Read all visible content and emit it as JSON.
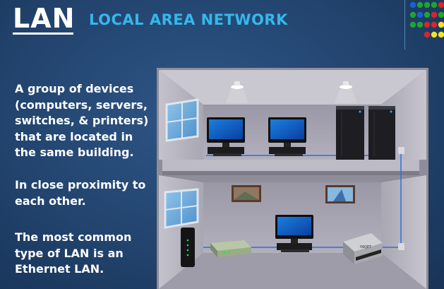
{
  "header": {
    "abbrev": "LAN",
    "title": "LOCAL AREA NETWORK"
  },
  "body_text": {
    "p1_lines": [
      "A group of devices",
      "(computers, servers,",
      "switches, & printers)",
      "that are located in",
      "the same building."
    ],
    "p2_lines": [
      "In close proximity to",
      "each other."
    ],
    "p3_lines": [
      "The most common",
      "type of LAN is an",
      "Ethernet LAN."
    ]
  },
  "colors": {
    "accent": "#35b7ec",
    "background": "#22446e",
    "dot_blue": "#1f5fd1",
    "dot_green": "#1fa52e",
    "dot_red": "#d8262a",
    "dot_yellow": "#f2e22a"
  },
  "dot_grid": [
    [
      "blue",
      "green",
      "green",
      "green",
      "red"
    ],
    [
      "green",
      "blue",
      "green",
      "red",
      "green"
    ],
    [
      "green",
      "green",
      "red",
      "red",
      "yellow"
    ],
    [
      "",
      "",
      "red",
      "yellow",
      "yellow"
    ]
  ],
  "illustration": {
    "devices": [
      "computer",
      "computer",
      "server",
      "server",
      "modem",
      "switch",
      "computer",
      "printer"
    ],
    "printer_label": "INKJET"
  }
}
